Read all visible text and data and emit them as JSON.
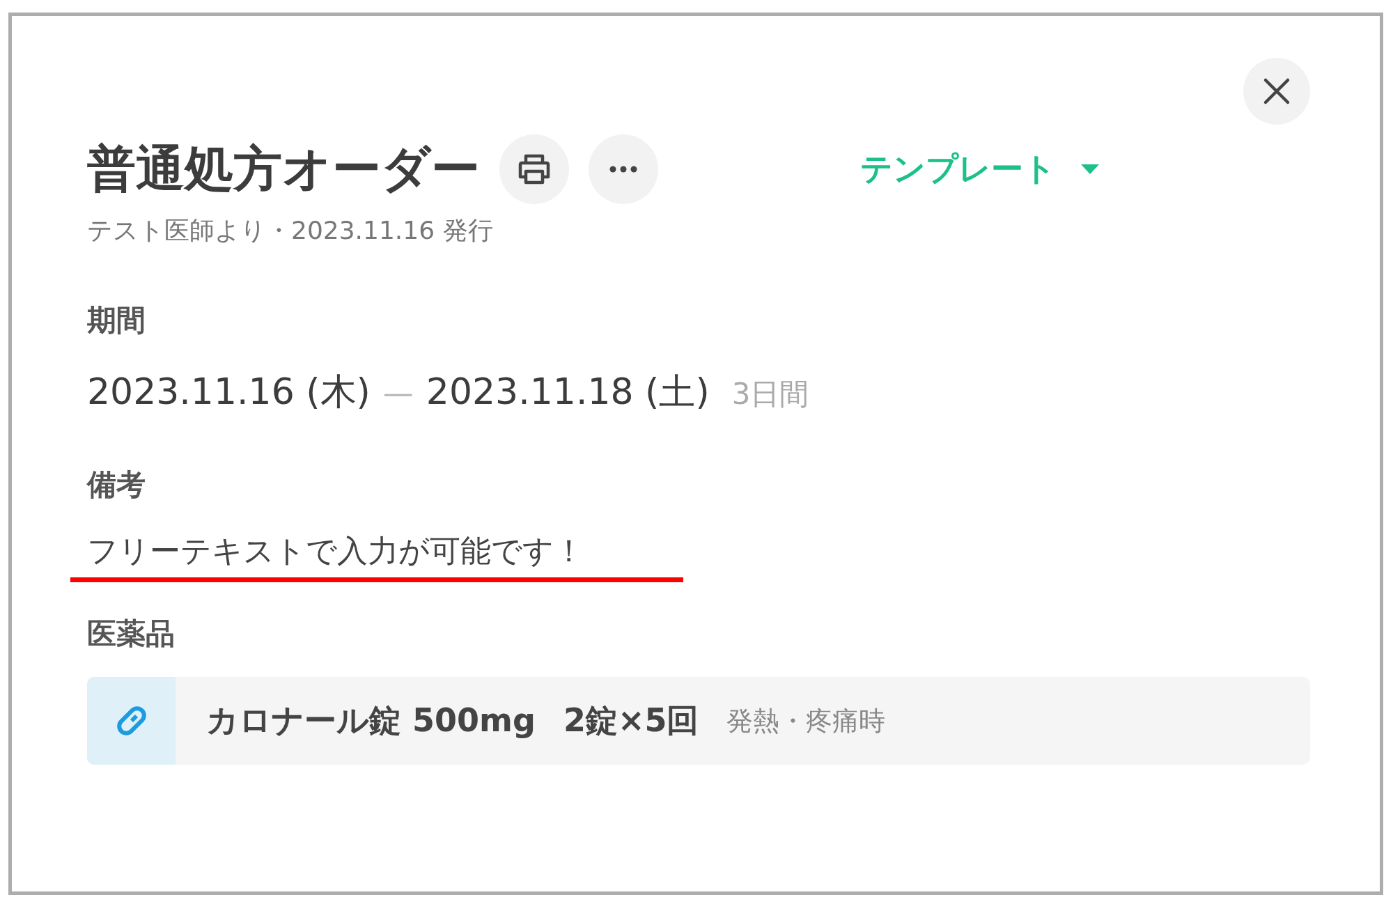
{
  "dialog": {
    "title": "普通処方オーダー",
    "subtitle": "テスト医師より・2023.11.16 発行",
    "template_menu": {
      "label": "テンプレート"
    }
  },
  "period": {
    "label": "期間",
    "start": "2023.11.16 (木)",
    "separator": "—",
    "end": "2023.11.18 (土)",
    "duration": "3日間"
  },
  "remarks": {
    "label": "備考",
    "text": "フリーテキストで入力が可能です！",
    "underlined": true
  },
  "medicines": {
    "label": "医薬品",
    "items": [
      {
        "name": "カロナール錠 500mg",
        "dosage": "2錠×5回",
        "note": "発熱・疼痛時"
      }
    ]
  }
}
